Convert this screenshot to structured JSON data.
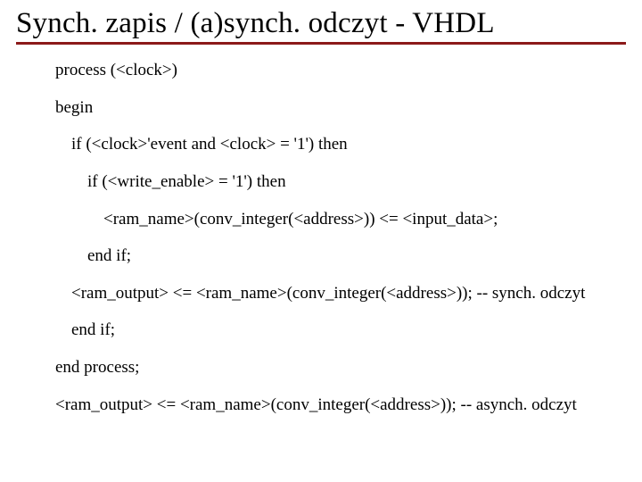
{
  "title": "Synch. zapis / (a)synch. odczyt - VHDL",
  "lines": {
    "l0": "process (<clock>)",
    "l1": "begin",
    "l2": "if (<clock>'event and <clock> = '1') then",
    "l3": "if (<write_enable> = '1') then",
    "l4": "<ram_name>(conv_integer(<address>)) <= <input_data>;",
    "l5": "end if;",
    "l6": "<ram_output> <= <ram_name>(conv_integer(<address>)); -- synch. odczyt",
    "l7": "end if;",
    "l8": "end process;",
    "l9": "<ram_output> <= <ram_name>(conv_integer(<address>)); -- asynch. odczyt"
  }
}
